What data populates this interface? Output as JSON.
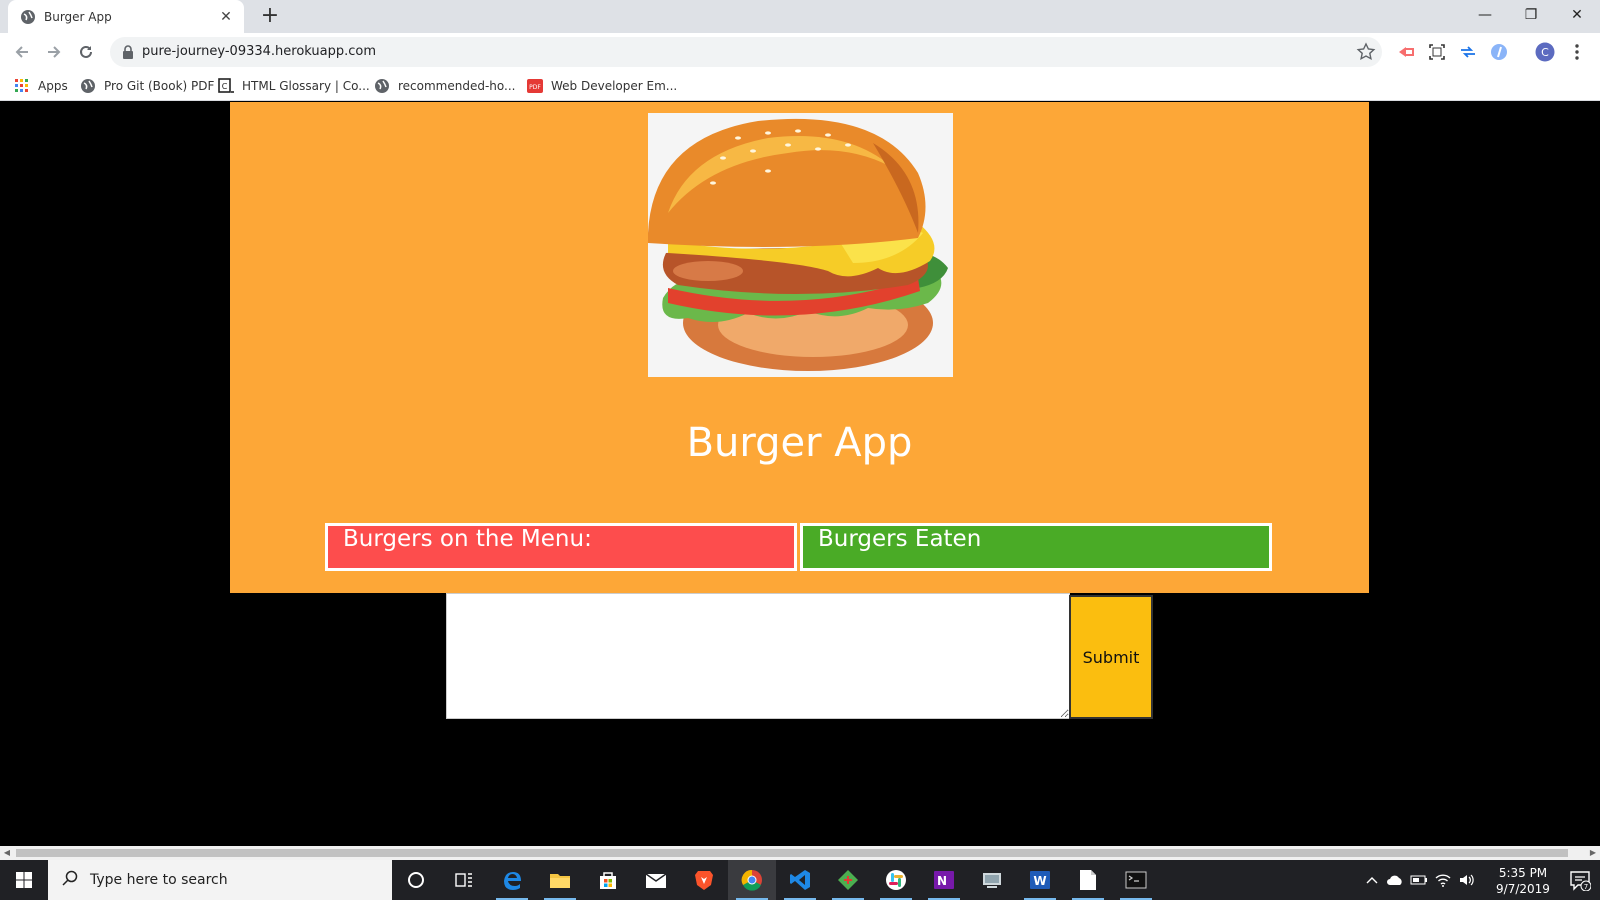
{
  "browser": {
    "tab_title": "Burger App",
    "new_tab_label": "+",
    "url": "pure-journey-09334.herokuapp.com",
    "window_controls": {
      "minimize": "—",
      "restore": "❐",
      "close": "✕"
    }
  },
  "bookmarks": [
    {
      "label": "Apps",
      "icon": "apps-grid-icon"
    },
    {
      "label": "Pro Git (Book) PDF",
      "icon": "globe-icon"
    },
    {
      "label": "HTML Glossary | Co...",
      "icon": "codecademy-icon"
    },
    {
      "label": "recommended-ho...",
      "icon": "globe-icon"
    },
    {
      "label": "Web Developer Em...",
      "icon": "pdf-icon"
    }
  ],
  "page": {
    "title": "Burger App",
    "menu_header": "Burgers on the Menu:",
    "eaten_header": "Burgers Eaten",
    "textarea_value": "",
    "submit_label": "Submit",
    "colors": {
      "jumbotron": "#fda737",
      "menu": "#fd4d4d",
      "eaten": "#4aab26",
      "submit": "#fbbe0f"
    }
  },
  "taskbar": {
    "search_placeholder": "Type here to search",
    "apps": [
      "cortana-icon",
      "task-view-icon",
      "edge-icon",
      "file-explorer-icon",
      "store-icon",
      "mail-icon",
      "brave-icon",
      "chrome-icon",
      "vscode-icon",
      "git-icon",
      "slack-icon",
      "onenote-icon",
      "network-icon",
      "word-icon",
      "notepad-icon",
      "terminal-icon"
    ],
    "time": "5:35 PM",
    "date": "9/7/2019",
    "notifications": "7"
  }
}
